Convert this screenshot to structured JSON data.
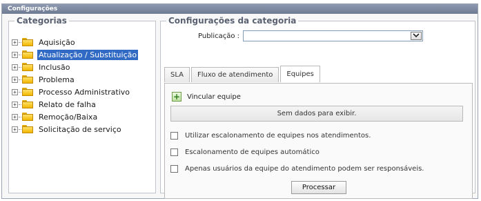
{
  "window": {
    "title": "Configurações"
  },
  "categories": {
    "legend": "Categorias",
    "items": [
      {
        "label": "Aquisição",
        "selected": false
      },
      {
        "label": "Atualização / Substituição",
        "selected": true
      },
      {
        "label": "Inclusão",
        "selected": false
      },
      {
        "label": "Problema",
        "selected": false
      },
      {
        "label": "Processo Administrativo",
        "selected": false
      },
      {
        "label": "Relato de falha",
        "selected": false
      },
      {
        "label": "Remoção/Baixa",
        "selected": false
      },
      {
        "label": "Solicitação de serviço",
        "selected": false
      }
    ]
  },
  "config": {
    "legend": "Configurações da categoria",
    "publicacao_label": "Publicação :",
    "publicacao_value": "",
    "tabs": [
      {
        "label": "SLA",
        "active": false
      },
      {
        "label": "Fluxo de atendimento",
        "active": false
      },
      {
        "label": "Equipes",
        "active": true
      }
    ],
    "vincular_label": "Vincular equipe",
    "empty_text": "Sem dados para exibir.",
    "options": [
      {
        "label": "Utilizar escalonamento de equipes nos atendimentos.",
        "checked": false
      },
      {
        "label": "Escalonamento de equipes automático",
        "checked": false
      },
      {
        "label": "Apenas usuários da equipe do atendimento podem ser responsáveis.",
        "checked": false
      }
    ],
    "process_button": "Processar"
  }
}
